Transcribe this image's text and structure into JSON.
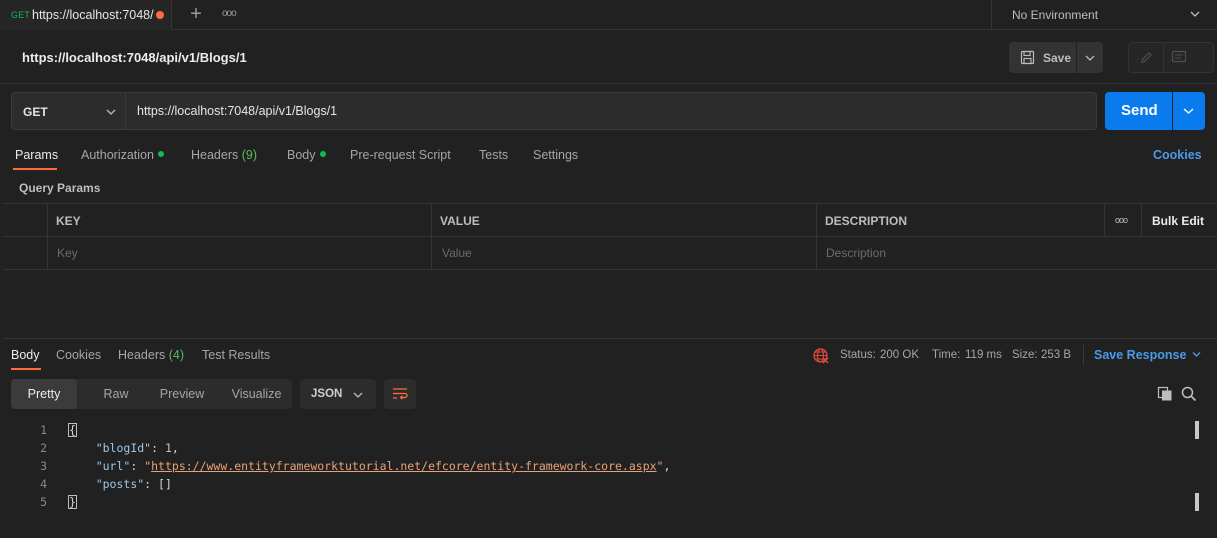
{
  "tab": {
    "method": "GET",
    "title": "https://localhost:7048/"
  },
  "tabbar": {
    "plus": "+",
    "more": "ooo"
  },
  "environment": {
    "label": "No Environment"
  },
  "request": {
    "title": "https://localhost:7048/api/v1/Blogs/1",
    "method": "GET",
    "url": "https://localhost:7048/api/v1/Blogs/1",
    "save_label": "Save",
    "send_label": "Send"
  },
  "request_tabs": {
    "params": "Params",
    "authorization": "Authorization",
    "headers": "Headers",
    "headers_count": "(9)",
    "body": "Body",
    "prerequest": "Pre-request Script",
    "tests": "Tests",
    "settings": "Settings",
    "cookies": "Cookies"
  },
  "query_params": {
    "label": "Query Params",
    "columns": [
      "KEY",
      "VALUE",
      "DESCRIPTION"
    ],
    "placeholders": [
      "Key",
      "Value",
      "Description"
    ],
    "more": "ooo",
    "bulk_edit": "Bulk Edit"
  },
  "response_tabs": {
    "body": "Body",
    "cookies": "Cookies",
    "headers": "Headers",
    "headers_count": "(4)",
    "test_results": "Test Results"
  },
  "response_status": {
    "status_label": "Status:",
    "status_value": "200 OK",
    "time_label": "Time:",
    "time_value": "119 ms",
    "size_label": "Size:",
    "size_value": "253 B",
    "save_response": "Save Response"
  },
  "format": {
    "pretty": "Pretty",
    "raw": "Raw",
    "preview": "Preview",
    "visualize": "Visualize",
    "language": "JSON"
  },
  "code": {
    "line_numbers": [
      "1",
      "2",
      "3",
      "4",
      "5"
    ],
    "open_brace": "{",
    "close_brace": "}",
    "blogId_key": "\"blogId\"",
    "blogId_value": "1",
    "url_key": "\"url\"",
    "url_value": "https://www.entityframeworktutorial.net/efcore/entity-framework-core.aspx",
    "posts_key": "\"posts\"",
    "posts_value": "[]"
  },
  "colors": {
    "accent": "#ff6c37",
    "send": "#097bed",
    "status_ok": "#5aba63",
    "link": "#4a9ae8"
  }
}
